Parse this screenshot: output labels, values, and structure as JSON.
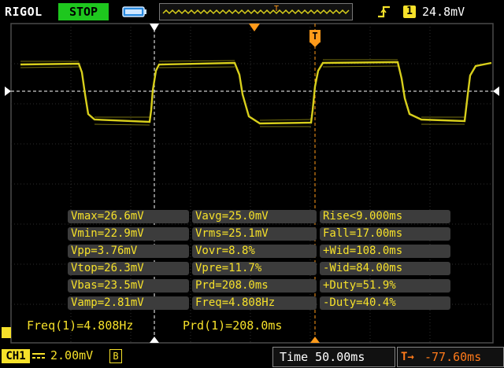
{
  "header": {
    "brand": "RIGOL",
    "run_state": "STOP",
    "trigger_source": "1",
    "trigger_level": "24.8mV"
  },
  "measurements": [
    [
      "Vmax=26.6mV",
      "Vavg=25.0mV",
      "Rise<9.000ms"
    ],
    [
      "Vmin=22.9mV",
      "Vrms=25.1mV",
      "Fall=17.00ms"
    ],
    [
      "Vpp=3.76mV",
      "Vovr=8.8%",
      "+Wid=108.0ms"
    ],
    [
      "Vtop=26.3mV",
      "Vpre=11.7%",
      "-Wid=84.00ms"
    ],
    [
      "Vbas=23.5mV",
      "Prd=208.0ms",
      "+Duty=51.9%"
    ],
    [
      "Vamp=2.81mV",
      "Freq=4.808Hz",
      "-Duty=40.4%"
    ]
  ],
  "footer_readouts": {
    "freq": "Freq(1)=4.808Hz",
    "period": "Prd(1)=208.0ms"
  },
  "status": {
    "channel": "CH1",
    "scale": "2.00mV",
    "bw_limit": "B",
    "timebase": "Time 50.00ms",
    "trigger_offset": "-77.60ms"
  },
  "colors": {
    "trace": "#d8cf1c",
    "grid": "#3a3a3a",
    "cursor": "#ffffff",
    "trigger": "#ff9a1a",
    "run_state": "#1ec71e"
  }
}
